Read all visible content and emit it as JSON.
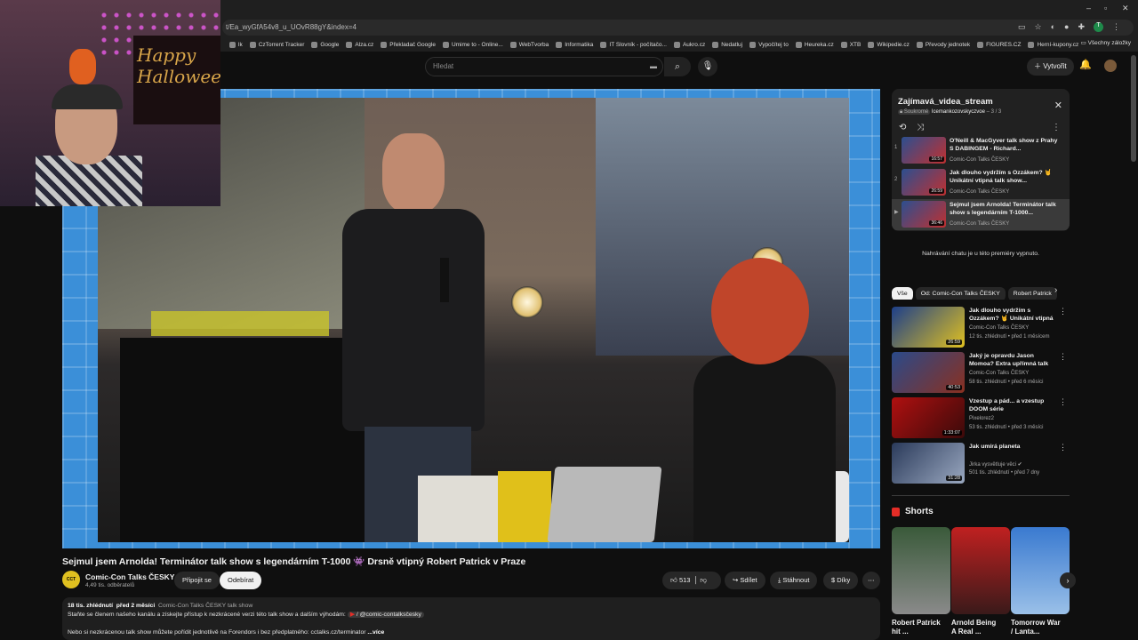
{
  "browser": {
    "url": "t/Ea_wyGfA54v8_u_UOvR88gY&index=4",
    "bookmarks": [
      "lk",
      "CzTorrent Tracker",
      "Google",
      "Alza.cz",
      "Překladač Google",
      "Umime to - Online...",
      "WebTvorba",
      "Informatika",
      "IT Slovník - počítačo...",
      "Aukro.cz",
      "Nedatluj",
      "Vypočítej to",
      "Heureka.cz",
      "XTB",
      "Wikipedie.cz",
      "Převody jednotek",
      "FIGURES.CZ",
      "Herní-kupony.cz"
    ],
    "bookmarks_folder": "Všechny záložky",
    "profile_initial": "T"
  },
  "header": {
    "search_placeholder": "Hledat",
    "create_label": "Vytvořit"
  },
  "webcam": {
    "sign_text": "Happy Halloween"
  },
  "video": {
    "title": "Sejmul jsem Arnolda! Terminátor talk show s legendárním T-1000 👾 Drsně vtipný Robert Patrick v Praze",
    "channel_name": "Comic-Con Talks ČESKY",
    "channel_avatar_text": "CCT",
    "subscribers": "4,49 tis. odběratelů",
    "join_label": "Připojit se",
    "subscribe_label": "Odebírat",
    "likes": "513",
    "share_label": "Sdílet",
    "download_label": "Stáhnout",
    "thanks_label": "Díky",
    "description": {
      "views": "18 tis. zhlédnutí",
      "age": "před 2 měsíci",
      "playlist_link": "Comic-Con Talks ČESKY talk show",
      "line1": "Staňte se členem našeho kanálu a získejte přístup k nezkrácené verzi této talk show a dalším výhodám:",
      "handle": "/ @comic-contalksčesky",
      "line2": "Nebo si nezkrácenou talk show můžete pořídit jednotlivě na Forendors i bez předplatného: cctalks.cz/terminator",
      "more": "...více"
    }
  },
  "playlist": {
    "title": "Zajímavá_videa_stream",
    "privacy": "Soukromé",
    "owner": "Icemankozovskyczvoe",
    "position": "3 / 3",
    "items": [
      {
        "index": "1",
        "title": "O'Neill & MacGyver talk show z Prahy S DABINGEM - Richard...",
        "channel": "Comic-Con Talks ČESKY",
        "duration": "16:57"
      },
      {
        "index": "2",
        "title": "Jak dlouho vydržím s Ozzákem? 🤘 Unikátní vtipná talk show...",
        "channel": "Comic-Con Talks ČESKY",
        "duration": "26:59"
      },
      {
        "index": "▶",
        "title": "Sejmul jsem Arnolda! Terminátor talk show s legendárním T-1000...",
        "channel": "Comic-Con Talks ČESKY",
        "duration": "36:46"
      }
    ]
  },
  "chat_notice": "Nahrávání chatu je u této premiéry vypnuto.",
  "chips": [
    "Vše",
    "Od: Comic-Con Talks ČESKY",
    "Robert Patrick"
  ],
  "recommendations": [
    {
      "title": "Jak dlouho vydržím s Ozzákem? 🤘 Unikátní vtipná talk show...",
      "channel": "Comic-Con Talks ČESKY",
      "meta": "12 tis. zhlédnutí • před 1 měsícem",
      "duration": "26:59",
      "colors": [
        "#1d3f8a",
        "#e0c020"
      ]
    },
    {
      "title": "Jaký je opravdu Jason Momoa? Extra upřímná talk show česky...",
      "channel": "Comic-Con Talks ČESKY",
      "meta": "58 tis. zhlédnutí • před 6 měsíci",
      "duration": "40:53",
      "colors": [
        "#2a4a8a",
        "#8a3020"
      ]
    },
    {
      "title": "Vzestup a pád... a vzestup DOOM série",
      "channel": "Pixelorez2",
      "meta": "53 tis. zhlédnutí • před 3 měsíci",
      "duration": "1:33:07",
      "colors": [
        "#b01010",
        "#3a0a0a"
      ]
    },
    {
      "title": "Jak umírá planeta",
      "channel": "Jirka vysvětluje věci ✔",
      "meta": "501 tis. zhlédnutí • před 7 dny",
      "duration": "31:28",
      "colors": [
        "#2a3a5a",
        "#9aa8c0"
      ]
    }
  ],
  "shorts": {
    "heading": "Shorts",
    "items": [
      {
        "title": "Robert Patrick hit ...",
        "colors": [
          "#3a5a3a",
          "#8a8a8a"
        ]
      },
      {
        "title": "Arnold Being A Real ...",
        "colors": [
          "#c02020",
          "#3a1a1a"
        ]
      },
      {
        "title": "Tomorrow War / Lanta...",
        "colors": [
          "#3a7ad0",
          "#9ac0e8"
        ]
      }
    ]
  }
}
